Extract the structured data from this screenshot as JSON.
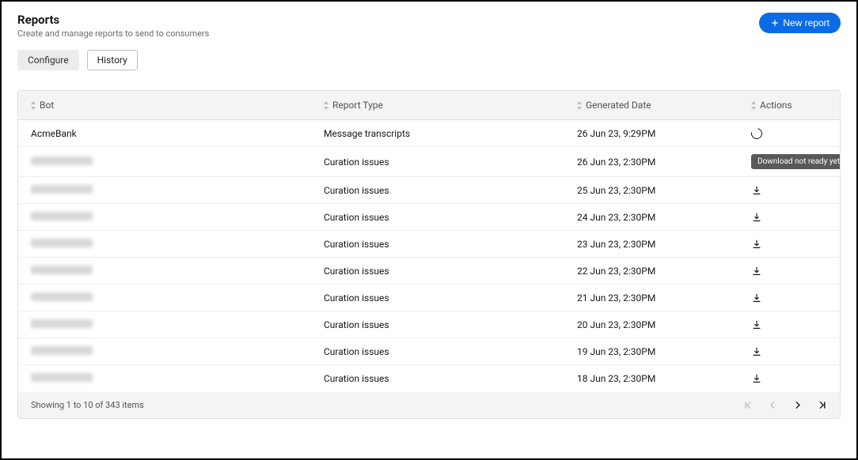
{
  "header": {
    "title": "Reports",
    "subtitle": "Create and manage reports to send to consumers",
    "new_report_label": "New report"
  },
  "tabs": {
    "configure": "Configure",
    "history": "History"
  },
  "table": {
    "columns": {
      "bot": "Bot",
      "report_type": "Report Type",
      "generated_date": "Generated Date",
      "actions": "Actions"
    },
    "rows": [
      {
        "bot": "AcmeBank",
        "type": "Message transcripts",
        "date": "26 Jun 23, 9:29PM",
        "action": "pending"
      },
      {
        "bot": "",
        "type": "Curation issues",
        "date": "26 Jun 23, 2:30PM",
        "action": "not_ready"
      },
      {
        "bot": "",
        "type": "Curation issues",
        "date": "25 Jun 23, 2:30PM",
        "action": "download"
      },
      {
        "bot": "",
        "type": "Curation issues",
        "date": "24 Jun 23, 2:30PM",
        "action": "download"
      },
      {
        "bot": "",
        "type": "Curation issues",
        "date": "23 Jun 23, 2:30PM",
        "action": "download"
      },
      {
        "bot": "",
        "type": "Curation issues",
        "date": "22 Jun 23, 2:30PM",
        "action": "download"
      },
      {
        "bot": "",
        "type": "Curation issues",
        "date": "21 Jun 23, 2:30PM",
        "action": "download"
      },
      {
        "bot": "",
        "type": "Curation issues",
        "date": "20 Jun 23, 2:30PM",
        "action": "download"
      },
      {
        "bot": "",
        "type": "Curation issues",
        "date": "19 Jun 23, 2:30PM",
        "action": "download"
      },
      {
        "bot": "",
        "type": "Curation issues",
        "date": "18 Jun 23, 2:30PM",
        "action": "download"
      }
    ],
    "not_ready_badge": "Download not ready yet",
    "footer_text": "Showing 1 to 10 of 343 items"
  }
}
